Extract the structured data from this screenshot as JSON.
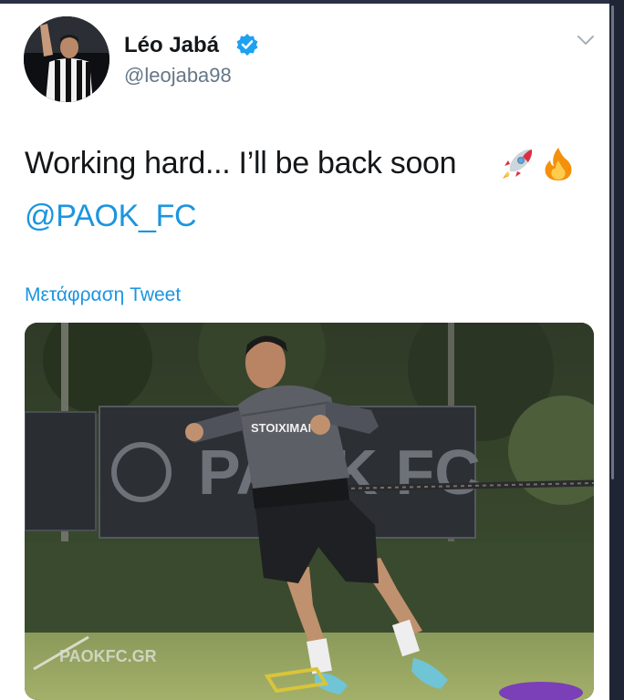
{
  "user": {
    "display_name": "Léo Jabá",
    "handle": "@leojaba98",
    "avatar_icon": "player-avatar",
    "verified_icon": "verified-badge-icon"
  },
  "tweet": {
    "text": "Working hard... I’ll be back soon",
    "emojis": [
      "rocket-emoji",
      "fire-emoji"
    ],
    "mention": "@PAOK_FC",
    "translate_label": "Μετάφραση Tweet"
  },
  "media": {
    "banner_text": "PAOK FC",
    "shirt_sponsor": "STOIXIMAN",
    "watermark": "PAOKFC.GR"
  },
  "colors": {
    "link": "#1b95e0",
    "text": "#14171a",
    "secondary": "#657786"
  }
}
